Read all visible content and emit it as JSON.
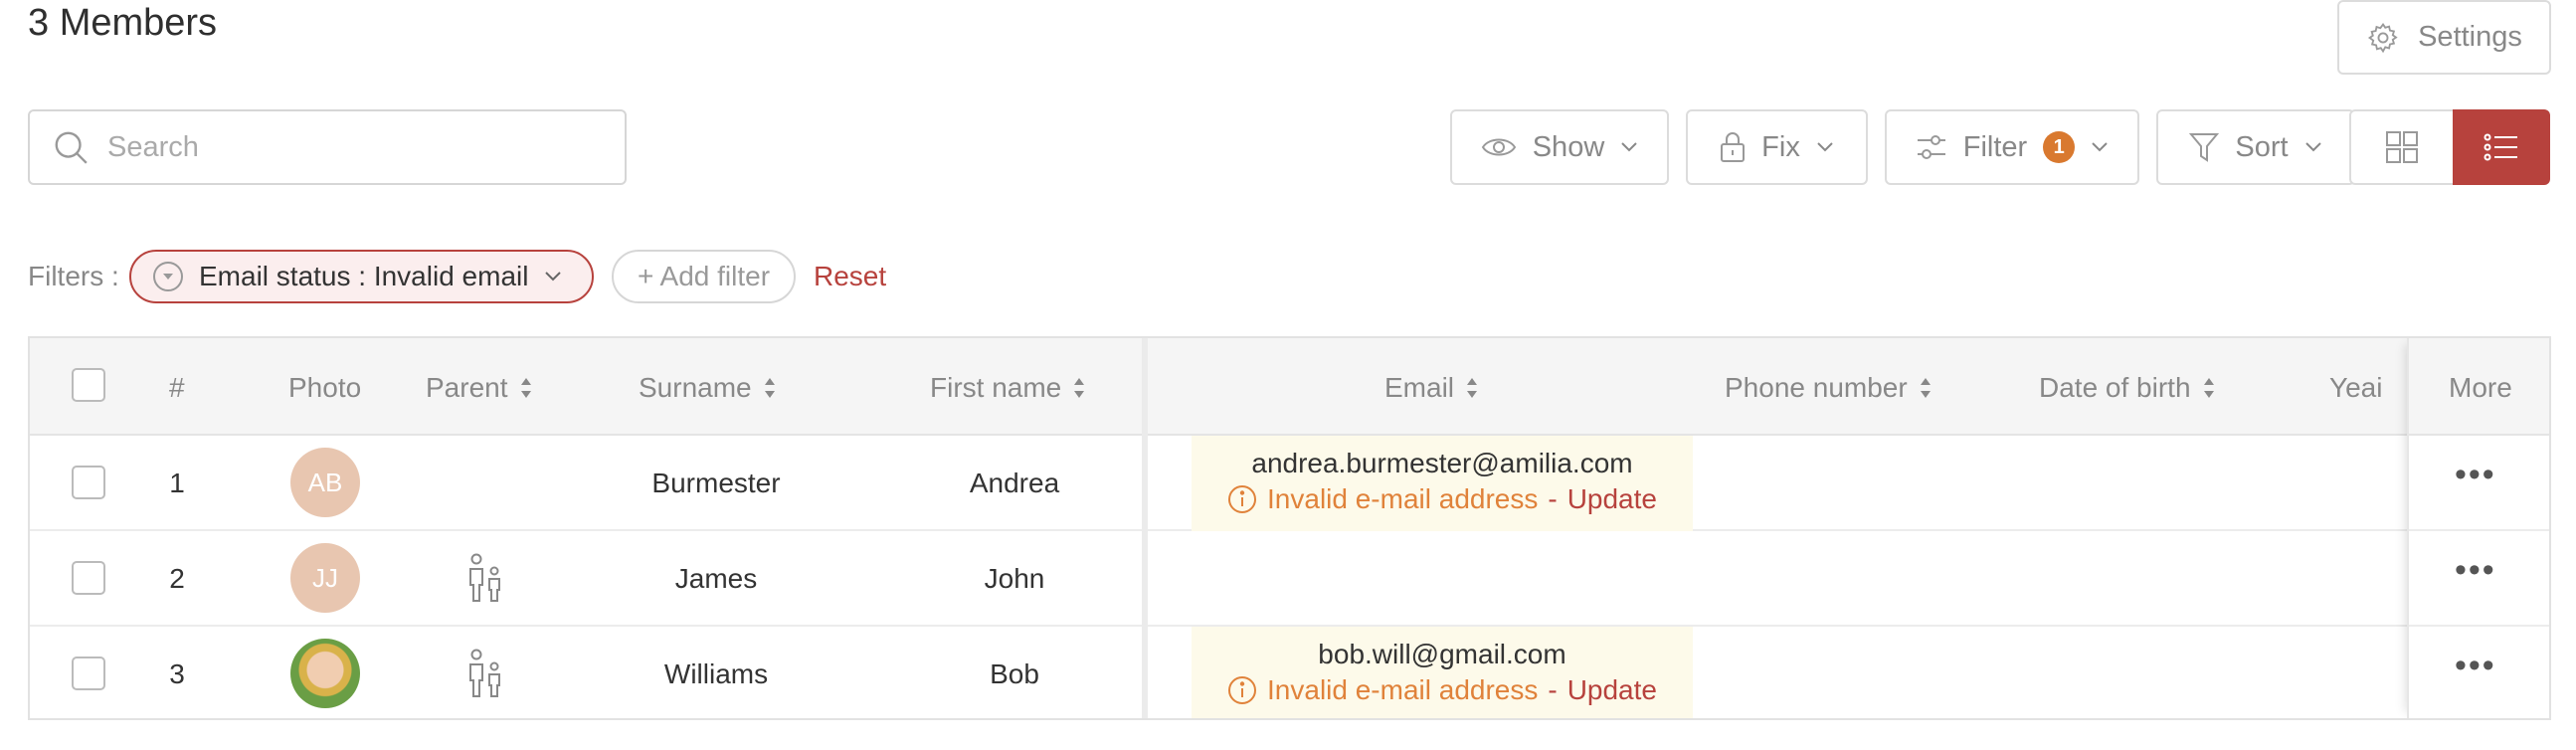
{
  "header": {
    "title": "3 Members",
    "settings_label": "Settings"
  },
  "search": {
    "placeholder": "Search",
    "value": ""
  },
  "toolbar": {
    "show_label": "Show",
    "fix_label": "Fix",
    "filter_label": "Filter",
    "filter_count": "1",
    "sort_label": "Sort"
  },
  "filters": {
    "label": "Filters :",
    "active_chip": "Email status : Invalid email",
    "add_label": "+ Add filter",
    "reset_label": "Reset"
  },
  "table": {
    "columns": {
      "index": "#",
      "photo": "Photo",
      "parent": "Parent",
      "surname": "Surname",
      "first_name": "First name",
      "email": "Email",
      "phone": "Phone number",
      "dob": "Date of birth",
      "year": "Yeai",
      "more": "More"
    },
    "rows": [
      {
        "index": "1",
        "initials": "AB",
        "surname": "Burmester",
        "first_name": "Andrea",
        "email": "andrea.burmester@amilia.com",
        "warning": "Invalid e-mail address",
        "separator": "-",
        "update": "Update"
      },
      {
        "index": "2",
        "initials": "JJ",
        "surname": "James",
        "first_name": "John",
        "email": "",
        "warning": "",
        "separator": "",
        "update": ""
      },
      {
        "index": "3",
        "initials": "",
        "surname": "Williams",
        "first_name": "Bob",
        "email": "bob.will@gmail.com",
        "warning": "Invalid e-mail address",
        "separator": "-",
        "update": "Update"
      }
    ]
  },
  "colors": {
    "accent": "#b7423d",
    "warning": "#e0823a",
    "badge": "#d9792f",
    "email_highlight": "#fdfaea",
    "avatar": "#e8c6b0"
  },
  "icons": [
    "gear-icon",
    "search-icon",
    "eye-icon",
    "lock-icon",
    "sliders-icon",
    "funnel-icon",
    "grid-view-icon",
    "list-view-icon",
    "chevron-down-icon",
    "sort-icon",
    "family-icon",
    "info-icon",
    "more-dots-icon"
  ]
}
